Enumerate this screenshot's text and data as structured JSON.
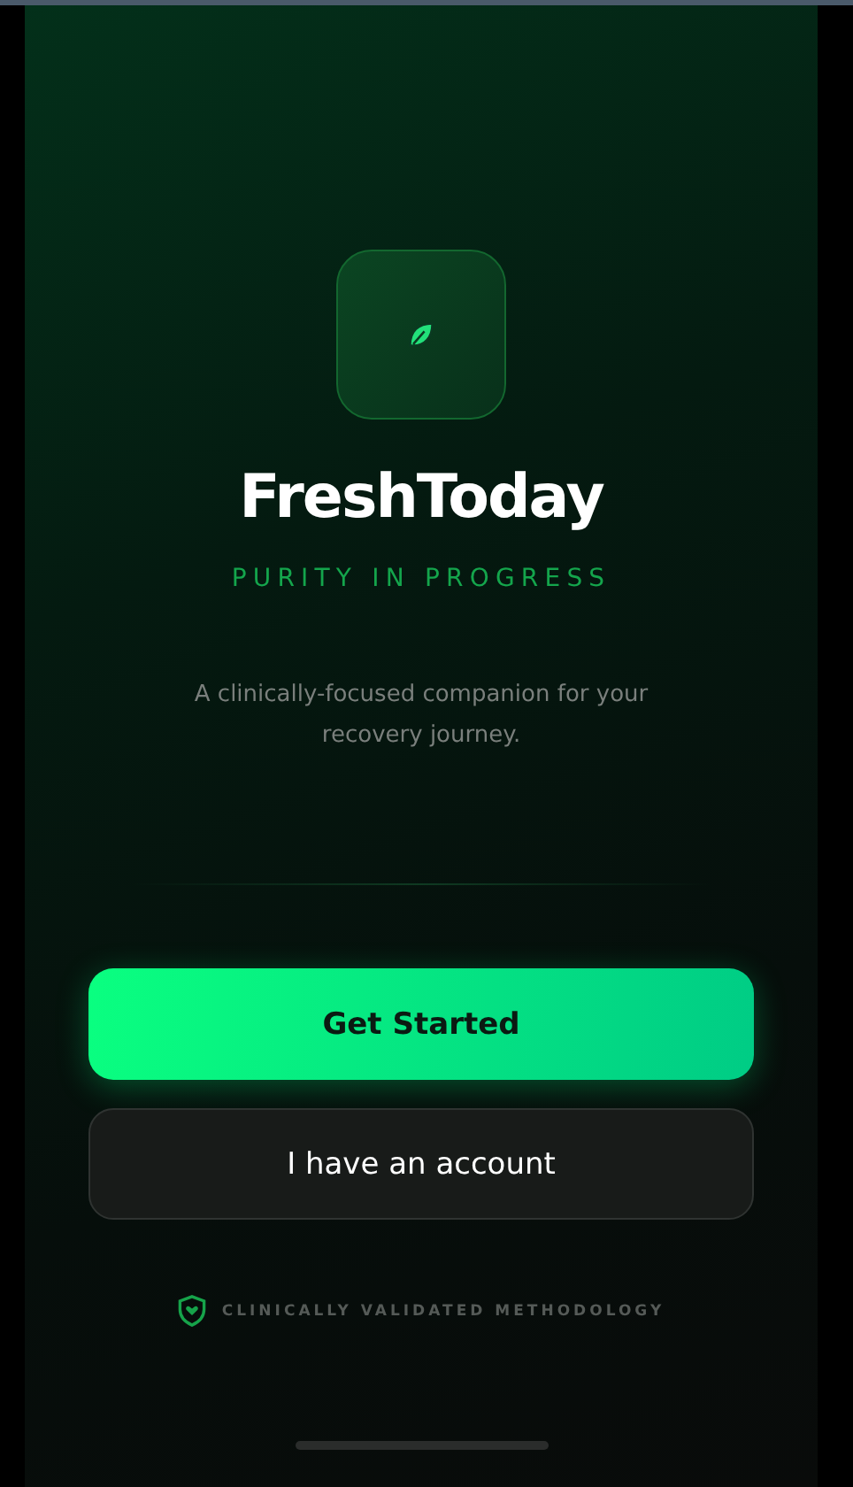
{
  "app": {
    "name": "FreshToday",
    "tagline": "PURITY IN PROGRESS",
    "description": "A clinically-focused companion for your recovery journey."
  },
  "buttons": [
    {
      "label": "Get Started",
      "kind": "primary"
    },
    {
      "label": "I have an account",
      "kind": "secondary"
    }
  ],
  "footer": {
    "text": "CLINICALLY VALIDATED METHODOLOGY"
  }
}
